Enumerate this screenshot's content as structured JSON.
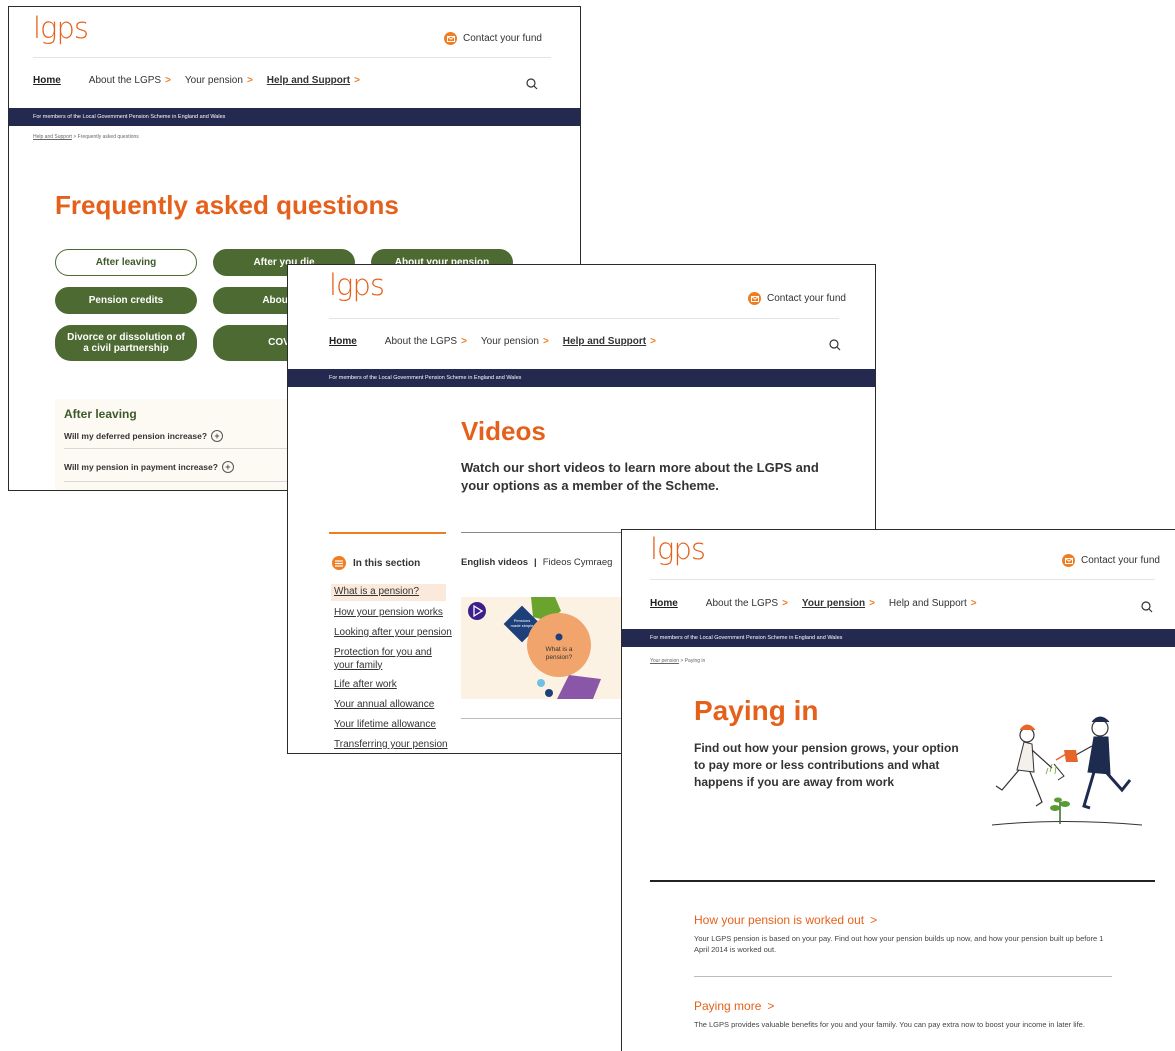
{
  "site": {
    "logo": "lgps",
    "contact": "Contact your fund",
    "banner": "For members of the Local Government Pension Scheme in England and Wales",
    "nav": {
      "home": "Home",
      "about": "About the LGPS",
      "pension": "Your pension",
      "help": "Help and Support",
      "chevron": ">"
    }
  },
  "faq": {
    "breadcrumb_link": "Help and Support",
    "breadcrumb_rest": " > Frequently asked questions",
    "title": "Frequently asked questions",
    "pills": [
      "After leaving",
      "After you die",
      "About your pension",
      "Pension credits",
      "About yo",
      "Divorce or dissolution of a civil partnership",
      "COVID"
    ],
    "section_title": "After leaving",
    "questions": [
      "Will my deferred pension increase?",
      "Will my pension in payment increase?"
    ]
  },
  "videos": {
    "title": "Videos",
    "intro": "Watch our short videos to learn more about the LGPS and your options as a member of the Scheme.",
    "in_this_section": "In this section",
    "side_links": [
      "What is a pension?",
      "How your pension works",
      "Looking after your pension",
      "Protection for you and your family",
      "Life after work",
      "Your annual allowance",
      "Your lifetime allowance",
      "Transferring your pension"
    ],
    "tab_english": "English videos",
    "tab_separator": "|",
    "tab_welsh": "Fideos Cymraeg",
    "thumb_label": "What is a pension?",
    "thumb_small_label": "Pensions made simple"
  },
  "paying": {
    "breadcrumb_link": "Your pension",
    "breadcrumb_rest": " > Paying in",
    "title": "Paying in",
    "intro": "Find out how your pension grows, your option to pay more or less contributions and what happens if you are away from work",
    "sections": [
      {
        "title": "How your pension is worked out",
        "desc": "Your LGPS pension is based on your pay. Find out how your pension builds up now, and how your pension built up before 1 April 2014 is worked out."
      },
      {
        "title": "Paying more",
        "desc": "The LGPS provides valuable benefits for you and your family. You can pay extra now to boost your income in later life."
      }
    ]
  },
  "colors": {
    "brand_orange": "#e5611b",
    "navy_banner": "#24294f",
    "pill_green": "#4c6a32"
  }
}
